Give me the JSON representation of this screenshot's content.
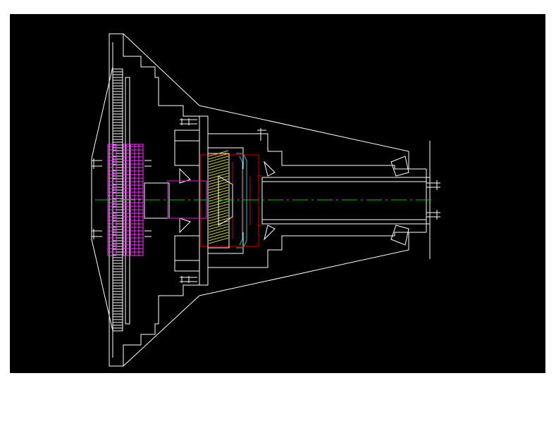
{
  "canvas": {
    "background": "#000000",
    "page_background": "#ffffff"
  },
  "colors": {
    "outline": "#ffffff",
    "centerline": "#00cc00",
    "hatch": "#ff33ff",
    "section": "#cc0000",
    "inner": "#00cccc",
    "gear": "#cccc33"
  },
  "drawing": {
    "type": "gearbox-cross-section",
    "parts": [
      "housing",
      "disc-pack",
      "splined-hub",
      "bevel-gear",
      "bearing",
      "output-shaft"
    ]
  }
}
